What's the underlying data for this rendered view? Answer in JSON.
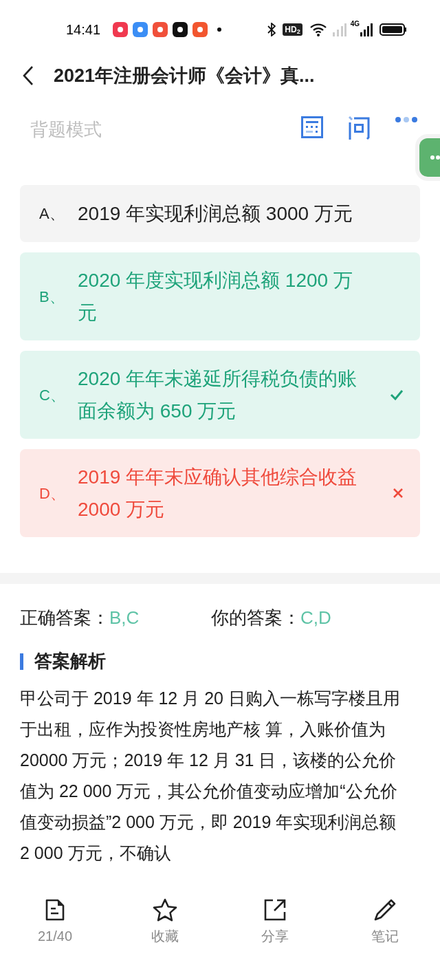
{
  "status_bar": {
    "time": "14:41",
    "hd": "HD$_{2}$",
    "network": "4G"
  },
  "header": {
    "title": "2021年注册会计师《会计》真..."
  },
  "toolbar": {
    "mode": "背题模式"
  },
  "options": [
    {
      "letter": "A、",
      "text": "2019 年实现利润总额 3000 万元",
      "kind": "plain",
      "chosen": false
    },
    {
      "letter": "B、",
      "text": "2020 年度实现利润总额 1200 万元",
      "kind": "correct",
      "chosen": false
    },
    {
      "letter": "C、",
      "text": "2020 年年末递延所得税负债的账面余额为 650 万元",
      "kind": "correct",
      "chosen": true
    },
    {
      "letter": "D、",
      "text": "2019 年年末应确认其他综合收益 2000 万元",
      "kind": "wrong",
      "chosen": true
    }
  ],
  "answers": {
    "correct_label": "正确答案：",
    "correct_value": "B,C",
    "yours_label": "你的答案：",
    "yours_value": "C,D"
  },
  "analysis": {
    "heading": "答案解析",
    "text": "甲公司于 2019 年 12 月 20 日购入一栋写字楼且用于出租，应作为投资性房地产核 算，入账价值为 20000 万元；2019 年 12 月 31 日，该楼的公允价值为 22 000 万元，其公允价值变动应增加“公允价值变动损益”2 000 万元，即 2019 年实现利润总额 2 000 万元，不确认"
  },
  "bottom_bar": [
    {
      "kind": "page",
      "label": "21/40"
    },
    {
      "kind": "star",
      "label": "收藏"
    },
    {
      "kind": "share",
      "label": "分享"
    },
    {
      "kind": "note",
      "label": "笔记"
    }
  ]
}
